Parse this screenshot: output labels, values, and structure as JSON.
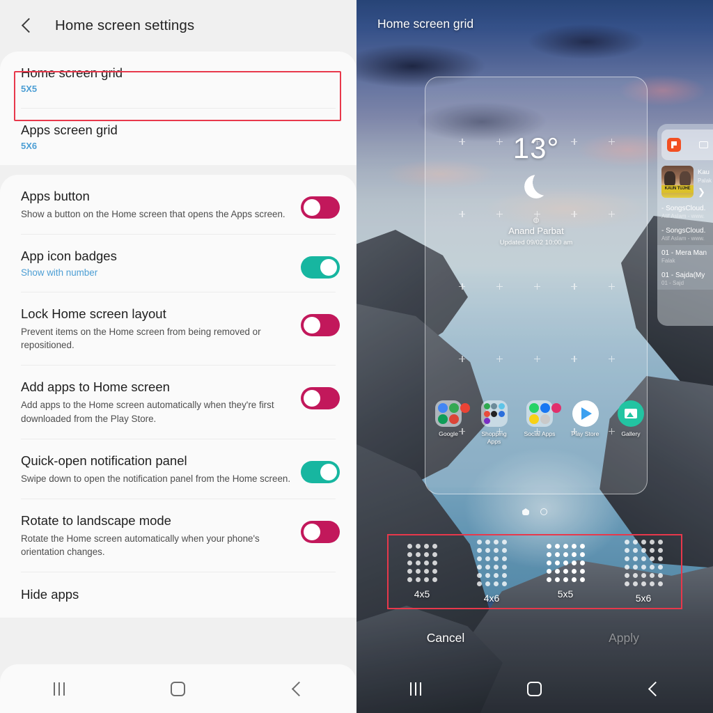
{
  "settings": {
    "header": {
      "title": "Home screen settings",
      "back_icon": "back-chevron-icon"
    },
    "grid_items": [
      {
        "title": "Home screen grid",
        "value": "5X5",
        "highlighted": true
      },
      {
        "title": "Apps screen grid",
        "value": "5X6",
        "highlighted": false
      }
    ],
    "toggle_items": [
      {
        "title": "Apps button",
        "desc": "Show a button on the Home screen that opens the Apps screen.",
        "state": "off"
      },
      {
        "title": "App icon badges",
        "sub": "Show with number",
        "state": "on"
      },
      {
        "title": "Lock Home screen layout",
        "desc": "Prevent items on the Home screen from being removed or repositioned.",
        "state": "off"
      },
      {
        "title": "Add apps to Home screen",
        "desc": "Add apps to the Home screen automatically when they're first downloaded from the Play Store.",
        "state": "off"
      },
      {
        "title": "Quick-open notification panel",
        "desc": "Swipe down to open the notification panel from the Home screen.",
        "state": "on"
      },
      {
        "title": "Rotate to landscape mode",
        "desc": "Rotate the Home screen automatically when your phone's orientation changes.",
        "state": "off"
      }
    ],
    "hide_apps": {
      "title": "Hide apps"
    },
    "navbar": {
      "recents": "recents-icon",
      "home": "home-icon",
      "back": "back-icon"
    },
    "colors": {
      "toggle_off": "#c2185b",
      "toggle_on": "#17b6a0",
      "accent_value": "#4c9ed4",
      "annotation": "#e8384b"
    }
  },
  "preview": {
    "title": "Home screen grid",
    "weather": {
      "temperature": "13°",
      "condition_icon": "moon-icon",
      "location": "Anand Parbat",
      "updated": "Updated 09/02 10:00 am",
      "refresh_icon": "refresh-icon",
      "location_pin_icon": "location-pin-icon"
    },
    "apps": [
      {
        "label": "Google",
        "type": "folder"
      },
      {
        "label": "Shopping Apps",
        "type": "folder"
      },
      {
        "label": "Social Apps",
        "type": "folder"
      },
      {
        "label": "Play Store",
        "type": "app"
      },
      {
        "label": "Gallery",
        "type": "app"
      }
    ],
    "page_dots": {
      "count": 2,
      "active": 0
    },
    "music_widget": {
      "now_playing_title": "Kau",
      "now_playing_artist": "Palak",
      "album_art_text": "KAUN TUJHE",
      "next_icon": "next-icon",
      "flipboard_icon": "flipboard-icon",
      "keyboard_icon": "keyboard-icon",
      "tracks": [
        {
          "title": "- SongsCloud.",
          "artist": "Atif Aslam - www."
        },
        {
          "title": "- SongsCloud.",
          "artist": "Atif Aslam - www."
        },
        {
          "title": "01 - Mera Man",
          "artist": "Falak"
        },
        {
          "title": "01 - Sajda(My",
          "artist": "01 - Sajd"
        }
      ]
    },
    "grid_options": [
      {
        "label": "4x5",
        "cols": 4,
        "rows": 5,
        "selected": false
      },
      {
        "label": "4x6",
        "cols": 4,
        "rows": 6,
        "selected": false
      },
      {
        "label": "5x5",
        "cols": 5,
        "rows": 5,
        "selected": true
      },
      {
        "label": "5x6",
        "cols": 5,
        "rows": 6,
        "selected": false
      }
    ],
    "actions": {
      "cancel": "Cancel",
      "apply": "Apply",
      "apply_enabled": false
    },
    "navbar": {
      "recents": "recents-icon",
      "home": "home-icon",
      "back": "back-icon"
    }
  }
}
